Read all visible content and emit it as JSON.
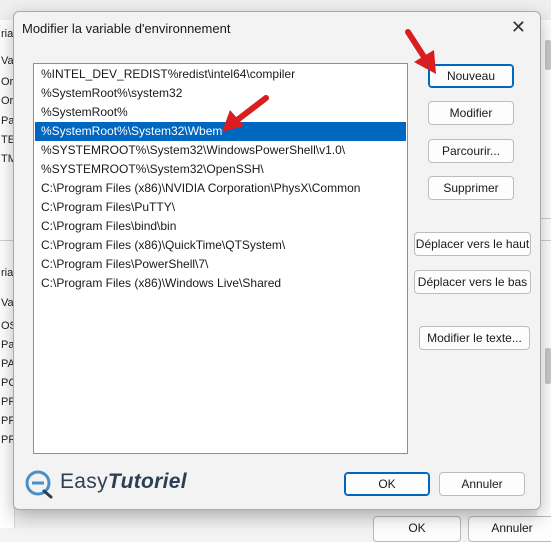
{
  "dialog": {
    "title": "Modifier la variable d'environnement",
    "close_glyph": "✕"
  },
  "path_list": [
    "%INTEL_DEV_REDIST%redist\\intel64\\compiler",
    "%SystemRoot%\\system32",
    "%SystemRoot%",
    "%SystemRoot%\\System32\\Wbem",
    "%SYSTEMROOT%\\System32\\WindowsPowerShell\\v1.0\\",
    "%SYSTEMROOT%\\System32\\OpenSSH\\",
    "C:\\Program Files (x86)\\NVIDIA Corporation\\PhysX\\Common",
    "C:\\Program Files\\PuTTY\\",
    "C:\\Program Files\\bind\\bin",
    "C:\\Program Files (x86)\\QuickTime\\QTSystem\\",
    "C:\\Program Files\\PowerShell\\7\\",
    "C:\\Program Files (x86)\\Windows Live\\Shared"
  ],
  "selected_index": 3,
  "buttons": {
    "new": "Nouveau",
    "edit": "Modifier",
    "browse": "Parcourir...",
    "delete": "Supprimer",
    "move_up": "Déplacer vers le haut",
    "move_down": "Déplacer vers le bas",
    "edit_text": "Modifier le texte...",
    "ok": "OK",
    "cancel": "Annuler"
  },
  "background": {
    "left_fragments": [
      "ria",
      "Va",
      "Or",
      "Or",
      "Pa",
      "TE",
      "TM",
      "ria",
      "Va",
      "OS",
      "Pa",
      "PA",
      "PC",
      "PR",
      "PR",
      "PR"
    ],
    "ok": "OK",
    "cancel": "Annuler"
  },
  "watermark": {
    "brand_prefix": "Easy",
    "brand_suffix": "Tutoriel"
  },
  "colors": {
    "selection": "#0067c0",
    "annotation_arrow": "#d81e1e",
    "brand": "#2d3f53"
  }
}
